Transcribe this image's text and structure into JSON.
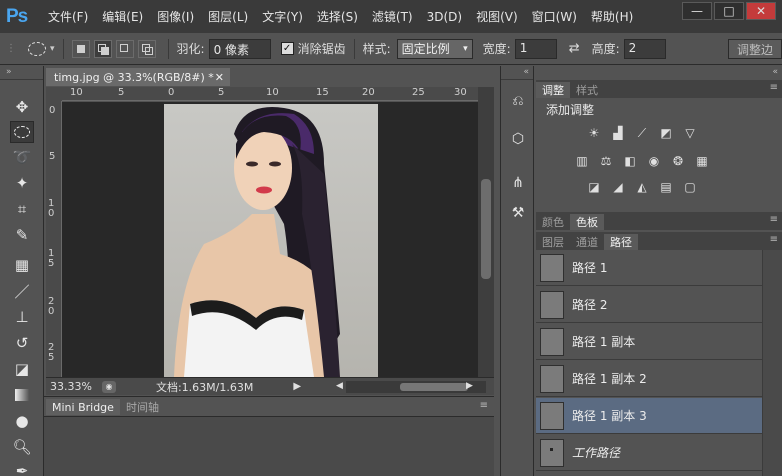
{
  "app": {
    "logo": "Ps"
  },
  "menu": [
    "文件(F)",
    "编辑(E)",
    "图像(I)",
    "图层(L)",
    "文字(Y)",
    "选择(S)",
    "滤镜(T)",
    "3D(D)",
    "视图(V)",
    "窗口(W)",
    "帮助(H)"
  ],
  "window_controls": {
    "minimize": "—",
    "maximize": "□",
    "close": "✕"
  },
  "options": {
    "feather_label": "羽化:",
    "feather_value": "0 像素",
    "antialias_label": "消除锯齿",
    "style_label": "样式:",
    "style_value": "固定比例",
    "width_label": "宽度:",
    "width_value": "1",
    "height_label": "高度:",
    "height_value": "2",
    "refine_button": "调整边"
  },
  "document": {
    "tab_title": "timg.jpg @ 33.3%(RGB/8#) *",
    "ruler_top": [
      "10",
      "5",
      "0",
      "5",
      "10",
      "15",
      "20",
      "25",
      "30"
    ],
    "ruler_left": [
      "0",
      "5",
      "1 0",
      "1 5",
      "2 0",
      "2 5"
    ],
    "zoom": "33.33%",
    "doc_info": "文档:1.63M/1.63M"
  },
  "bottom_panel": {
    "tabs": [
      "Mini Bridge",
      "时间轴"
    ]
  },
  "adjustments": {
    "tabs": [
      "调整",
      "样式"
    ],
    "title": "添加调整"
  },
  "color_tabs": [
    "颜色",
    "色板"
  ],
  "layer_tabs": [
    "图层",
    "通道",
    "路径"
  ],
  "paths": [
    {
      "name": "路径 1",
      "selected": false
    },
    {
      "name": "路径 2",
      "selected": false
    },
    {
      "name": "路径 1 副本",
      "selected": false
    },
    {
      "name": "路径 1 副本 2",
      "selected": false
    },
    {
      "name": "路径 1 副本 3",
      "selected": true
    },
    {
      "name": "工作路径",
      "selected": false
    }
  ],
  "colors": {
    "selected_row": "#5b6b82",
    "ps_logo": "#4aa6f0"
  }
}
